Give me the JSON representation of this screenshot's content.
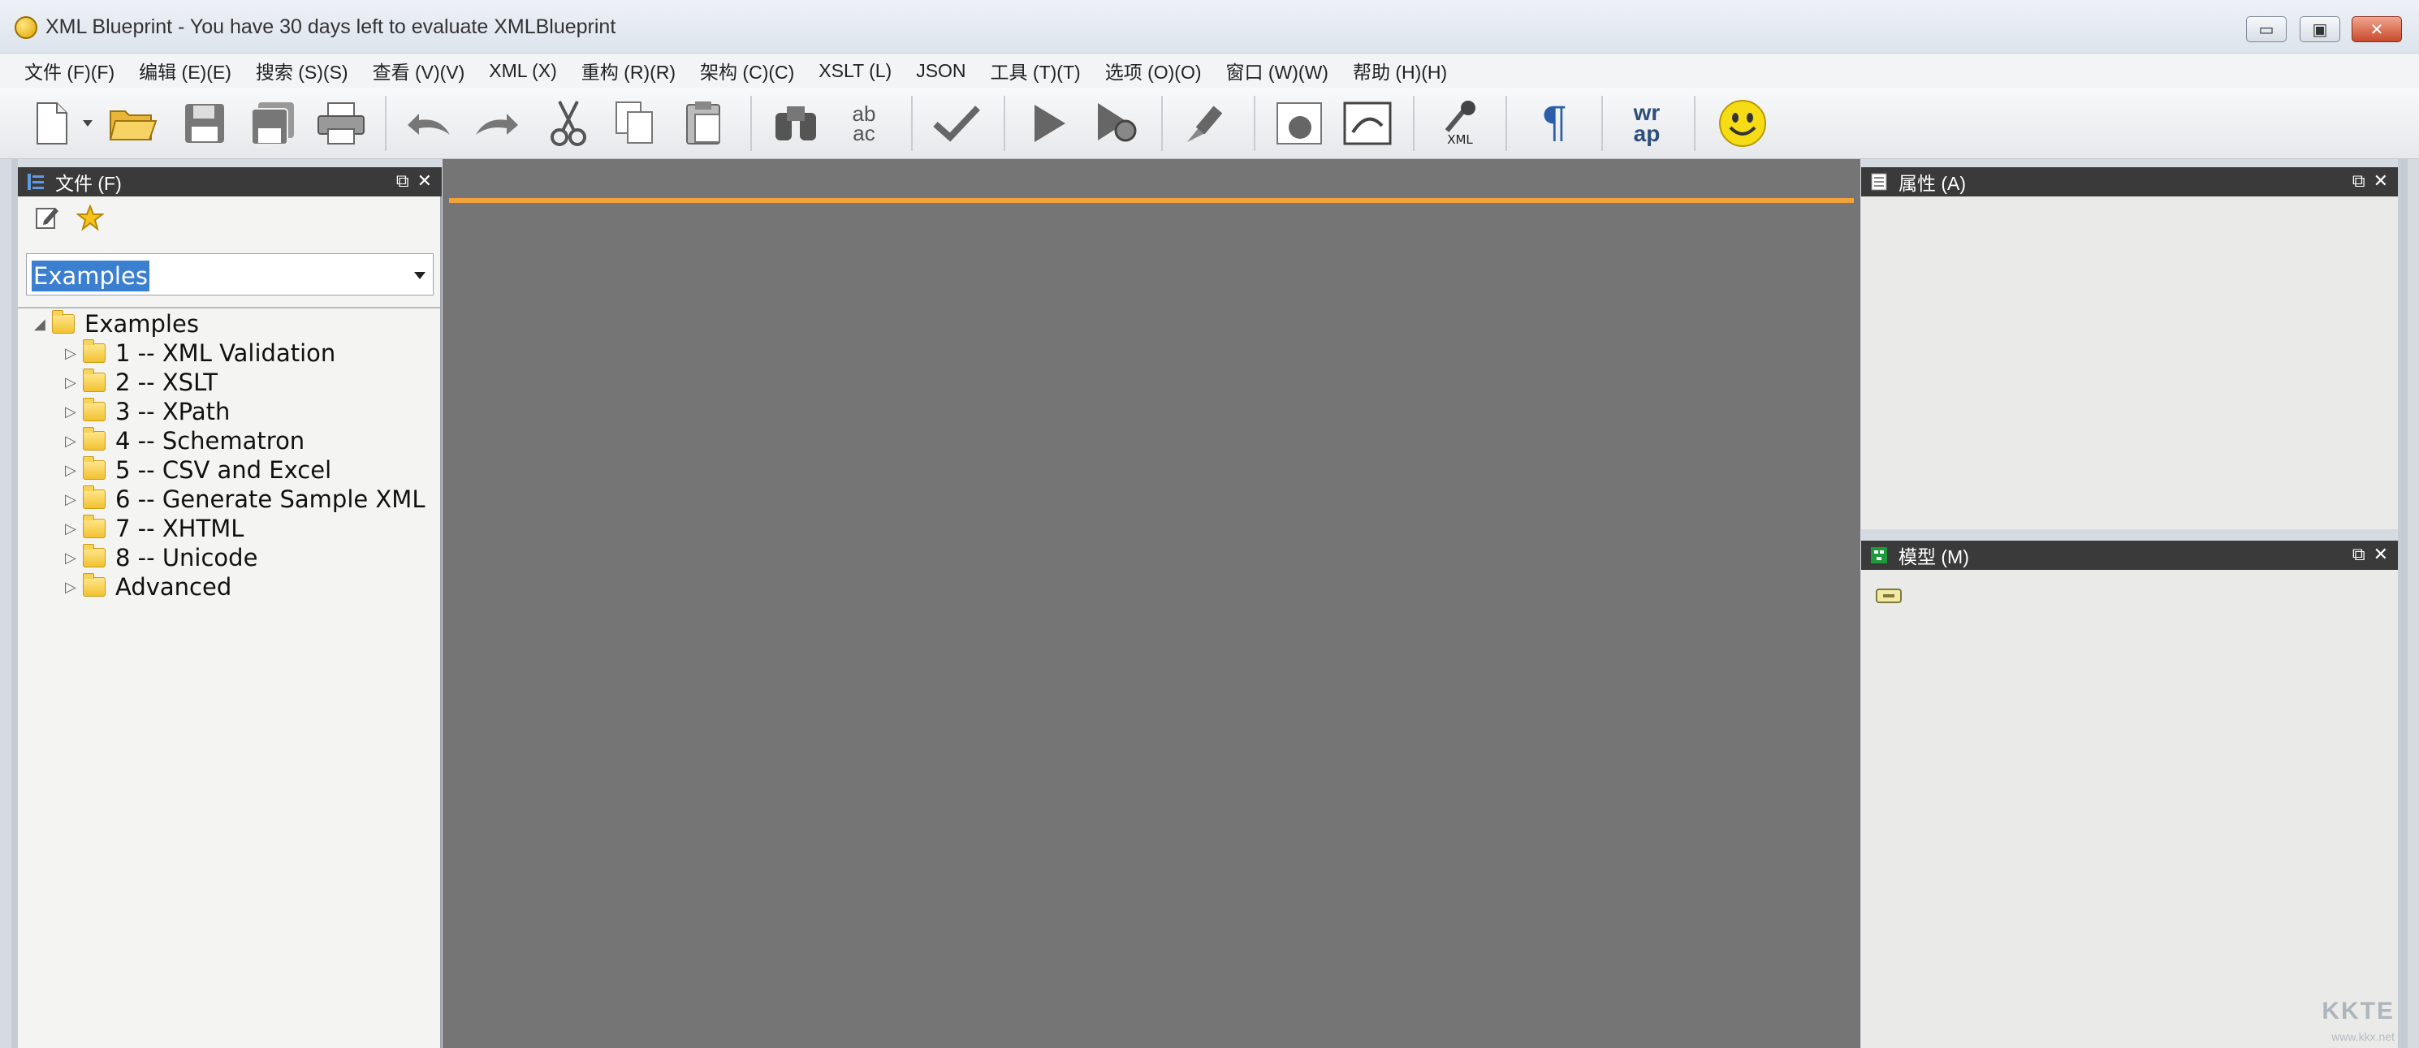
{
  "window": {
    "title": "XML Blueprint - You have 30 days left to evaluate XMLBlueprint",
    "minimize_label": "▭",
    "maximize_label": "▣",
    "close_label": "✕"
  },
  "menu": [
    {
      "label": "文件 (F)(F)"
    },
    {
      "label": "编辑 (E)(E)"
    },
    {
      "label": "搜索 (S)(S)"
    },
    {
      "label": "查看 (V)(V)"
    },
    {
      "label": "XML (X)"
    },
    {
      "label": "重构 (R)(R)"
    },
    {
      "label": "架构 (C)(C)"
    },
    {
      "label": "XSLT (L)"
    },
    {
      "label": "JSON"
    },
    {
      "label": "工具 (T)(T)"
    },
    {
      "label": "选项 (O)(O)"
    },
    {
      "label": "窗口 (W)(W)"
    },
    {
      "label": "帮助 (H)(H)"
    }
  ],
  "toolbar": {
    "icons": [
      "new-icon",
      "new-dropdown-icon",
      "open-icon",
      "save-icon",
      "save-all-icon",
      "print-icon",
      "undo-icon",
      "redo-icon",
      "cut-icon",
      "copy-icon",
      "paste-icon",
      "find-icon",
      "replace-icon",
      "validate-icon",
      "run-icon",
      "debug-icon",
      "format-icon",
      "xml-tree-icon",
      "preview-icon",
      "xml-pick-icon",
      "paragraph-icon",
      "wrap-icon",
      "smiley-icon"
    ],
    "replace_text_top": "ab",
    "replace_text_bottom": "ac",
    "xml_label": "XML",
    "paragraph_glyph": "¶",
    "wrap_text_top": "wr",
    "wrap_text_bottom": "ap"
  },
  "files_panel": {
    "title": "文件 (F)",
    "combo_value": "Examples",
    "tree": [
      {
        "label": "Examples",
        "expanded": true
      },
      {
        "label": "1 -- XML Validation"
      },
      {
        "label": "2 -- XSLT"
      },
      {
        "label": "3 -- XPath"
      },
      {
        "label": "4 -- Schematron"
      },
      {
        "label": "5 -- CSV and Excel"
      },
      {
        "label": "6 -- Generate Sample XML"
      },
      {
        "label": "7 -- XHTML"
      },
      {
        "label": "8 -- Unicode"
      },
      {
        "label": "Advanced"
      }
    ]
  },
  "properties_panel": {
    "title": "属性 (A)"
  },
  "model_panel": {
    "title": "模型 (M)"
  },
  "panel_buttons": {
    "float": "⧉",
    "close": "✕"
  },
  "watermark": {
    "text": "KKTE",
    "sub": "www.kkx.net"
  },
  "colors": {
    "accent_line": "#f2a23a",
    "editor_bg": "#757575",
    "panel_header": "#3a3a3a"
  }
}
